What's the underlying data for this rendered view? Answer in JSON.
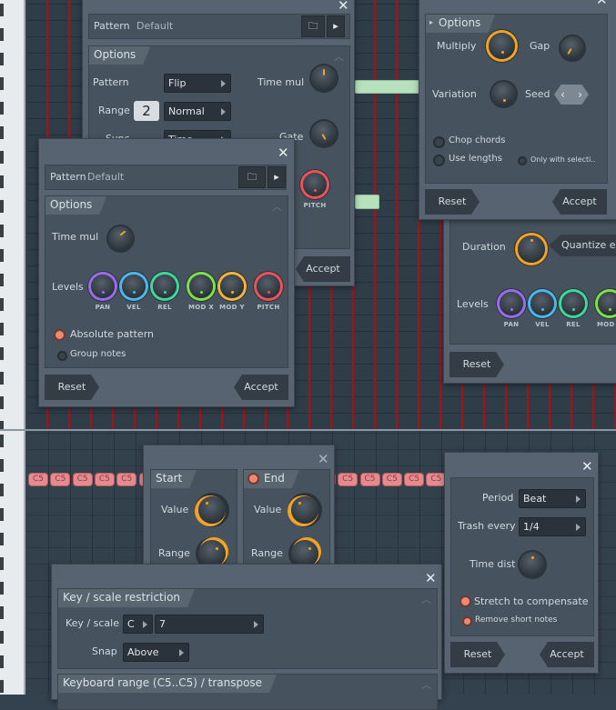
{
  "background": {
    "note_label": "C5",
    "note_count": 19
  },
  "pattern_back": {
    "pattern_label": "Pattern",
    "pattern_value": "Default",
    "options_title": "Options",
    "pattern_field_label": "Pattern",
    "pattern_select": "Flip",
    "range_label": "Range",
    "range_value": "2",
    "range_select": "Normal",
    "sync_label": "Sync",
    "sync_select": "Time",
    "time_mul_label": "Time mul",
    "gate_label": "Gate",
    "pitch_caption": "PITCH",
    "accept": "Accept"
  },
  "pattern_front": {
    "pattern_label": "Pattern",
    "pattern_value": "Default",
    "options_title": "Options",
    "time_mul_label": "Time mul",
    "levels_label": "Levels",
    "levels": [
      {
        "label": "PAN",
        "color": "#9a6bf0"
      },
      {
        "label": "VEL",
        "color": "#4db6ec"
      },
      {
        "label": "REL",
        "color": "#3ed89a"
      },
      {
        "label": "MOD X",
        "color": "#7ee04a"
      },
      {
        "label": "MOD Y",
        "color": "#f2b43a"
      },
      {
        "label": "PITCH",
        "color": "#f0505a"
      }
    ],
    "absolute_pattern": "Absolute pattern",
    "absolute_pattern_checked": true,
    "group_notes": "Group notes",
    "group_notes_checked": false,
    "reset": "Reset",
    "accept": "Accept"
  },
  "chop": {
    "options_title": "Options",
    "multiply_label": "Multiply",
    "gap_label": "Gap",
    "variation_label": "Variation",
    "seed_label": "Seed",
    "chop_chords": "Chop chords",
    "use_lengths": "Use lengths",
    "only_with_selection": "Only with selecti..",
    "reset": "Reset",
    "accept": "Accept"
  },
  "quantize": {
    "duration_label": "Duration",
    "duration_select": "Quantize end",
    "levels_label": "Levels",
    "levels": [
      {
        "label": "PAN",
        "color": "#9a6bf0"
      },
      {
        "label": "VEL",
        "color": "#4db6ec"
      },
      {
        "label": "REL",
        "color": "#3ed89a"
      },
      {
        "label": "MOD X",
        "color": "#7ee04a"
      }
    ],
    "reset": "Reset"
  },
  "limit": {
    "start_title": "Start",
    "end_title": "End",
    "end_enabled": true,
    "value_label": "Value",
    "range_label": "Range"
  },
  "scale": {
    "section1_title": "Key / scale restriction",
    "key_scale_label": "Key / scale",
    "key_value": "C",
    "scale_value": "7",
    "snap_label": "Snap",
    "snap_value": "Above",
    "section2_title": "Keyboard range (C5..C5) / transpose"
  },
  "trash": {
    "period_label": "Period",
    "period_value": "Beat",
    "trash_every_label": "Trash every",
    "trash_every_value": "1/4",
    "time_dist_label": "Time dist",
    "stretch": "Stretch to compensate",
    "stretch_checked": true,
    "remove_short": "Remove short notes",
    "remove_short_checked": true,
    "reset": "Reset",
    "accept": "Accept"
  }
}
